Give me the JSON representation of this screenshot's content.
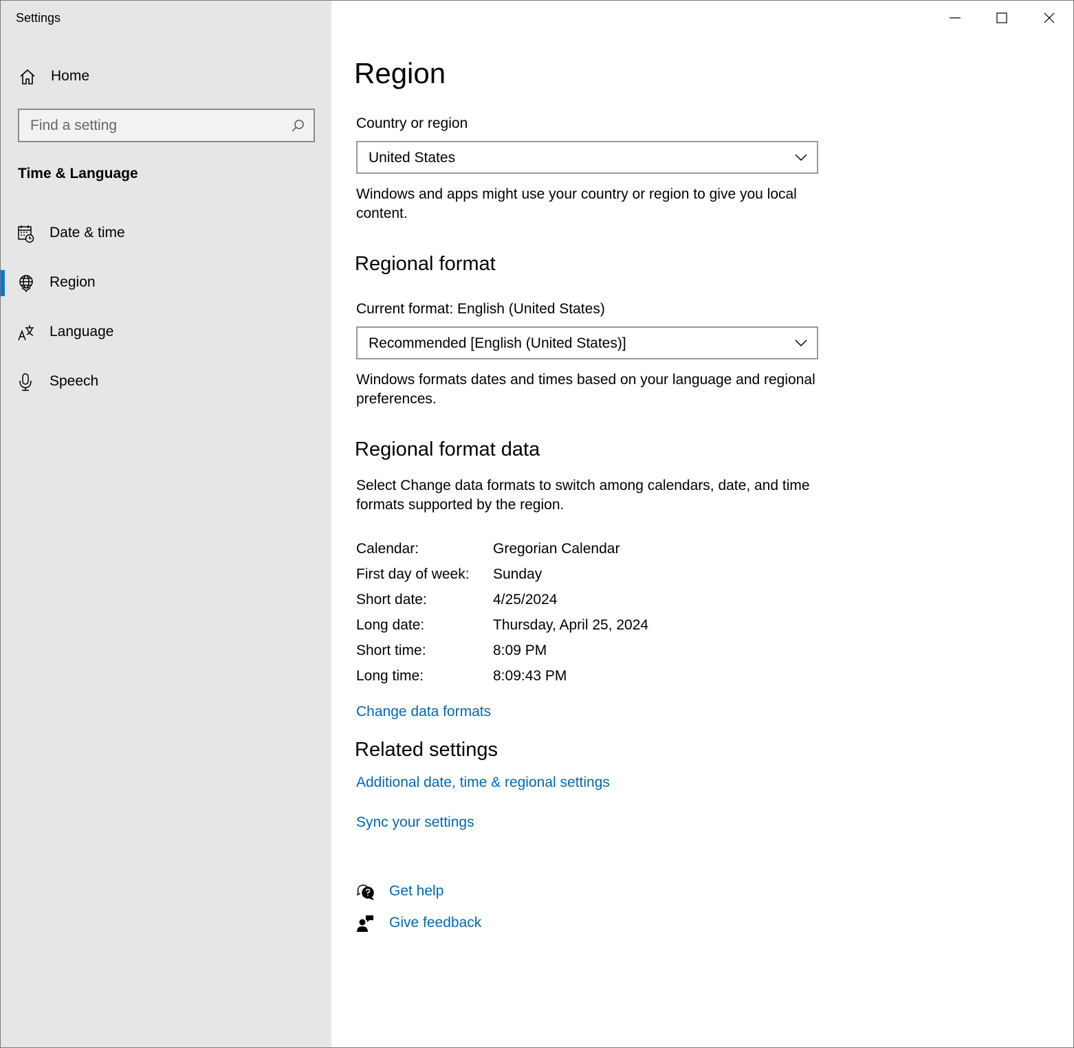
{
  "window": {
    "title": "Settings",
    "controls": {
      "minimize": "minimize",
      "maximize": "maximize",
      "close": "close"
    }
  },
  "sidebar": {
    "home_label": "Home",
    "search": {
      "placeholder": "Find a setting",
      "value": ""
    },
    "section_title": "Time & Language",
    "items": [
      {
        "label": "Date & time",
        "icon": "calendar-clock-icon",
        "selected": false
      },
      {
        "label": "Region",
        "icon": "globe-icon",
        "selected": true
      },
      {
        "label": "Language",
        "icon": "language-icon",
        "selected": false
      },
      {
        "label": "Speech",
        "icon": "microphone-icon",
        "selected": false
      }
    ],
    "accent_color": "#0078d7",
    "background": "#e6e6e6"
  },
  "main": {
    "title": "Region",
    "country": {
      "label": "Country or region",
      "selected": "United States",
      "description": "Windows and apps might use your country or region to give you local content."
    },
    "regional_format": {
      "heading": "Regional format",
      "current_label": "Current format: English (United States)",
      "selected": "Recommended [English (United States)]",
      "description": "Windows formats dates and times based on your language and regional preferences."
    },
    "format_data": {
      "heading": "Regional format data",
      "description": "Select Change data formats to switch among calendars, date, and time formats supported by the region.",
      "rows": [
        {
          "key": "Calendar:",
          "value": "Gregorian Calendar"
        },
        {
          "key": "First day of week:",
          "value": "Sunday"
        },
        {
          "key": "Short date:",
          "value": "4/25/2024"
        },
        {
          "key": "Long date:",
          "value": "Thursday, April 25, 2024"
        },
        {
          "key": "Short time:",
          "value": "8:09 PM"
        },
        {
          "key": "Long time:",
          "value": "8:09:43 PM"
        }
      ],
      "change_link": "Change data formats"
    },
    "related": {
      "heading": "Related settings",
      "links": [
        "Additional date, time & regional settings",
        "Sync your settings"
      ]
    },
    "help": {
      "get_help": "Get help",
      "give_feedback": "Give feedback"
    },
    "link_color": "#0067b8"
  }
}
